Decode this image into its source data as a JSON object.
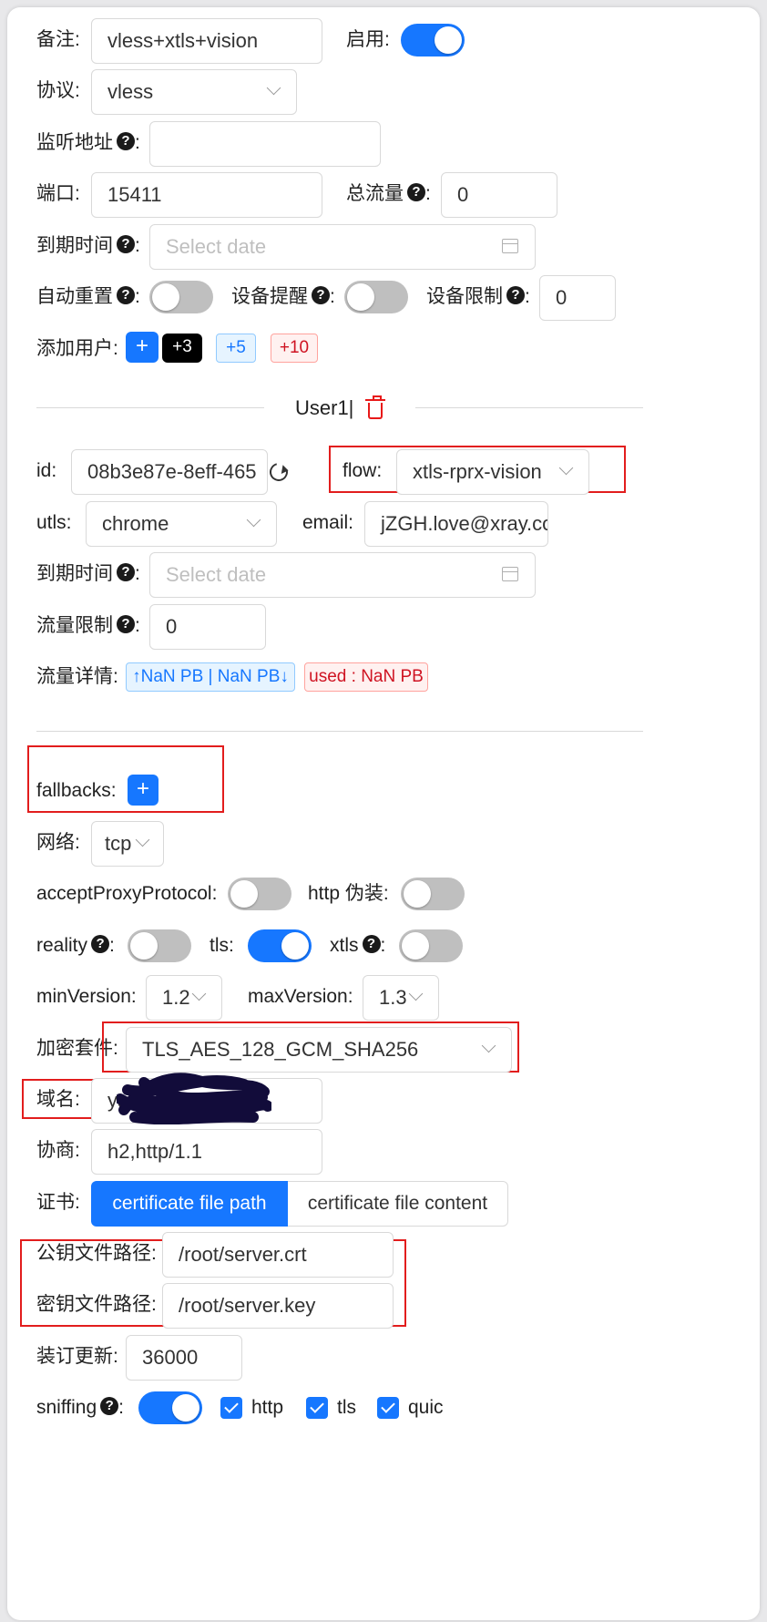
{
  "form": {
    "remark_label": "备注:",
    "remark_value": "vless+xtls+vision",
    "enable_label": "启用:",
    "protocol_label": "协议:",
    "protocol_value": "vless",
    "listen_label": "监听地址",
    "port_label": "端口:",
    "port_value": "15411",
    "total_label": "总流量",
    "total_value": "0",
    "expiry_label": "到期时间",
    "expiry_placeholder": "Select date",
    "auto_reset_label": "自动重置",
    "device_alert_label": "设备提醒",
    "device_limit_label": "设备限制",
    "device_limit_value": "0",
    "add_user_label": "添加用户:",
    "add_plus": "+",
    "add_3": "+3",
    "add_5": "+5",
    "add_10": "+10",
    "colon": ":"
  },
  "user": {
    "title": "User1|",
    "id_label": "id:",
    "id_value": "08b3e87e-8eff-465",
    "flow_label": "flow:",
    "flow_value": "xtls-rprx-vision",
    "utls_label": "utls:",
    "utls_value": "chrome",
    "email_label": "email:",
    "email_value": "jZGH.love@xray.co",
    "expiry_label": "到期时间",
    "expiry_placeholder": "Select date",
    "traffic_limit_label": "流量限制",
    "traffic_limit_value": "0",
    "traffic_detail_label": "流量详情:",
    "traffic_updown": "↑NaN PB | NaN PB↓",
    "traffic_used": "used : NaN PB"
  },
  "transport": {
    "fallbacks_label": "fallbacks:",
    "fallbacks_add": "+",
    "network_label": "网络:",
    "network_value": "tcp",
    "accept_proxy_label": "acceptProxyProtocol:",
    "http_camouflage_label": "http 伪装:",
    "reality_label": "reality",
    "tls_label": "tls:",
    "xtls_label": "xtls",
    "min_version_label": "minVersion:",
    "min_version_value": "1.2",
    "max_version_label": "maxVersion:",
    "max_version_value": "1.3",
    "cipher_label": "加密套件:",
    "cipher_value": "TLS_AES_128_GCM_SHA256",
    "domain_label": "域名:",
    "domain_value": "ya",
    "alpn_label": "协商:",
    "alpn_value": "h2,http/1.1",
    "cert_label": "证书:",
    "cert_tab_path": "certificate file path",
    "cert_tab_content": "certificate file content",
    "public_key_label": "公钥文件路径:",
    "public_key_value": "/root/server.crt",
    "private_key_label": "密钥文件路径:",
    "private_key_value": "/root/server.key",
    "reload_label": "装订更新:",
    "reload_value": "36000",
    "sniffing_label": "sniffing",
    "sniff_http": "http",
    "sniff_tls": "tls",
    "sniff_quic": "quic"
  },
  "colors": {
    "accent": "#1677ff",
    "annotation_red": "#e21d1d",
    "switch_off": "#bfbfbf"
  }
}
